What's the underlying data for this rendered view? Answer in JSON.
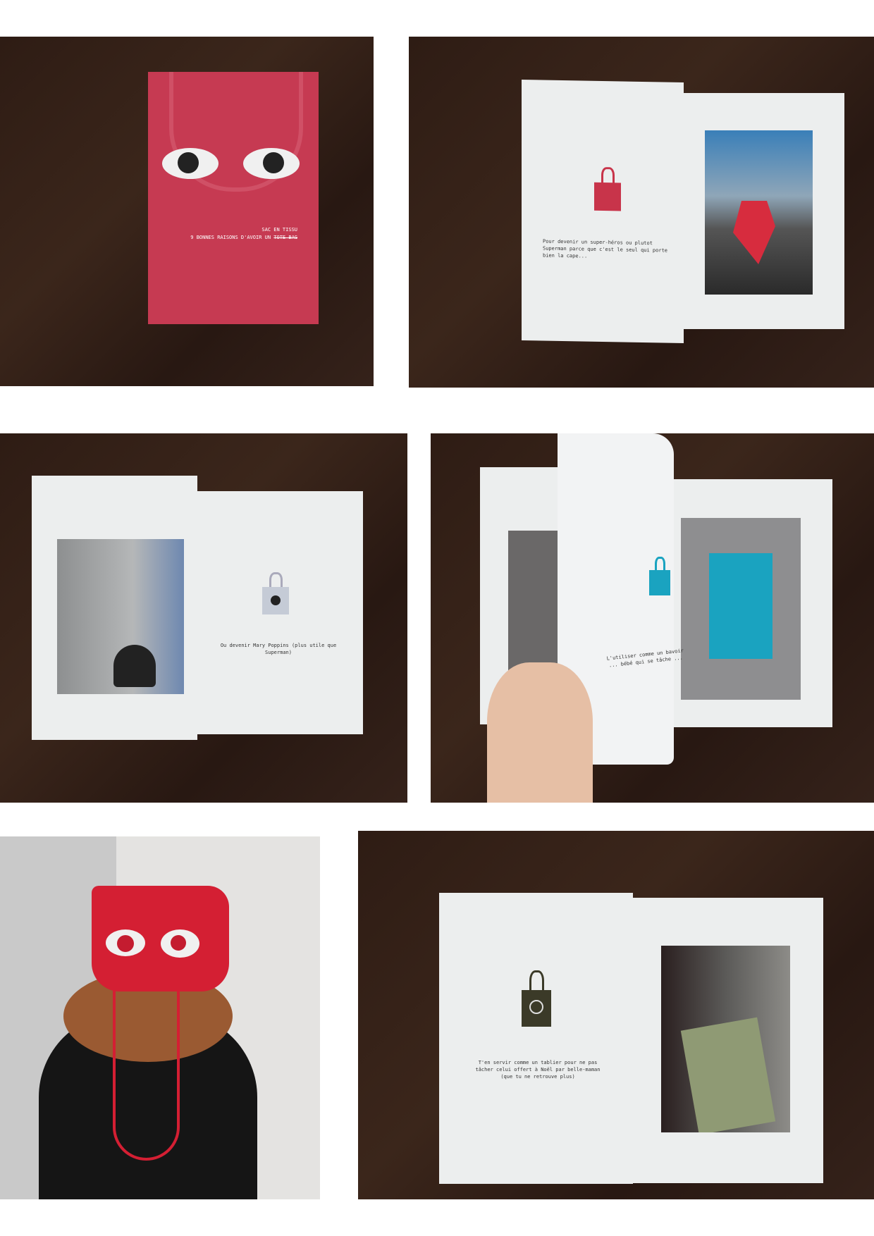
{
  "cover": {
    "title_line1": "SAC EN TISSU",
    "title_line2_prefix": "9 BONNES RAISONS D'AVOIR UN ",
    "title_struck": "TOTE BAG"
  },
  "spreads": [
    {
      "caption": "Pour devenir un super-héros ou plutot Superman parce que c'est le seul qui porte bien la cape..."
    },
    {
      "caption": "Ou devenir Mary Poppins (plus utile que Superman)"
    },
    {
      "caption": "L'utiliser comme un bavoir ... bébé qui se tâche ..."
    },
    {
      "caption": "T'en servir comme un tablier pour ne pas tâcher celui offert à Noël par belle-maman (que tu ne retrouve plus)"
    }
  ],
  "colors": {
    "bag_red": "#c8344a",
    "bag_blue": "#1aa3c0",
    "bag_olive": "#3b3a28",
    "table": "#30201a"
  }
}
